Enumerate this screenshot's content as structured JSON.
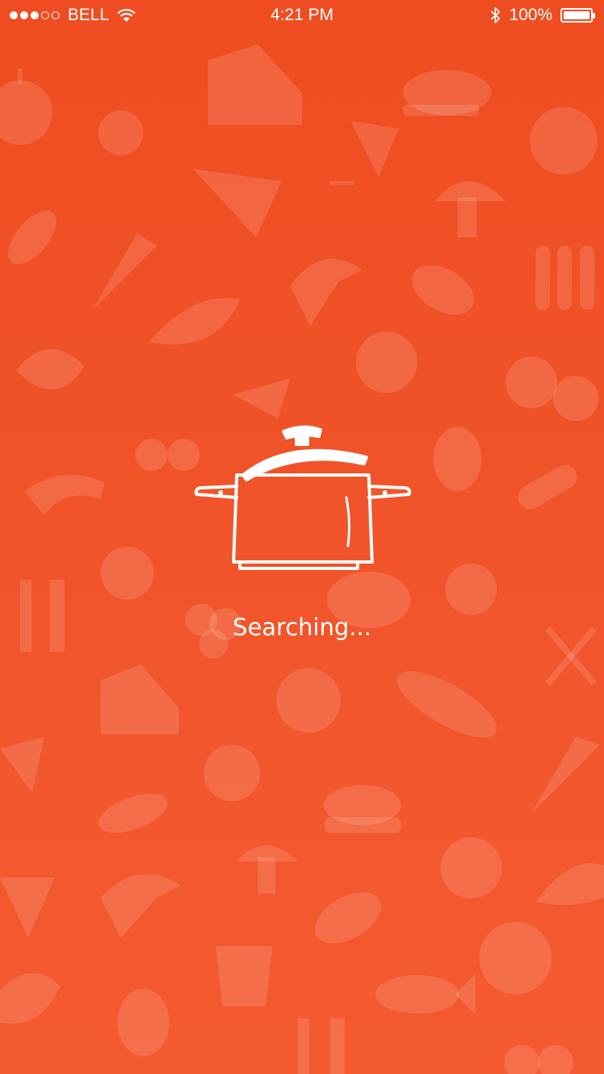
{
  "status_bar": {
    "carrier": "BELL",
    "time": "4:21 PM",
    "battery_percent": "100%",
    "signal_strength": 3,
    "signal_max": 5,
    "battery_level": 1.0
  },
  "loading": {
    "message": "Searching...",
    "icon": "cooking-pot-icon"
  },
  "theme": {
    "accent": "#ef4d21",
    "foreground": "#ffffff"
  }
}
